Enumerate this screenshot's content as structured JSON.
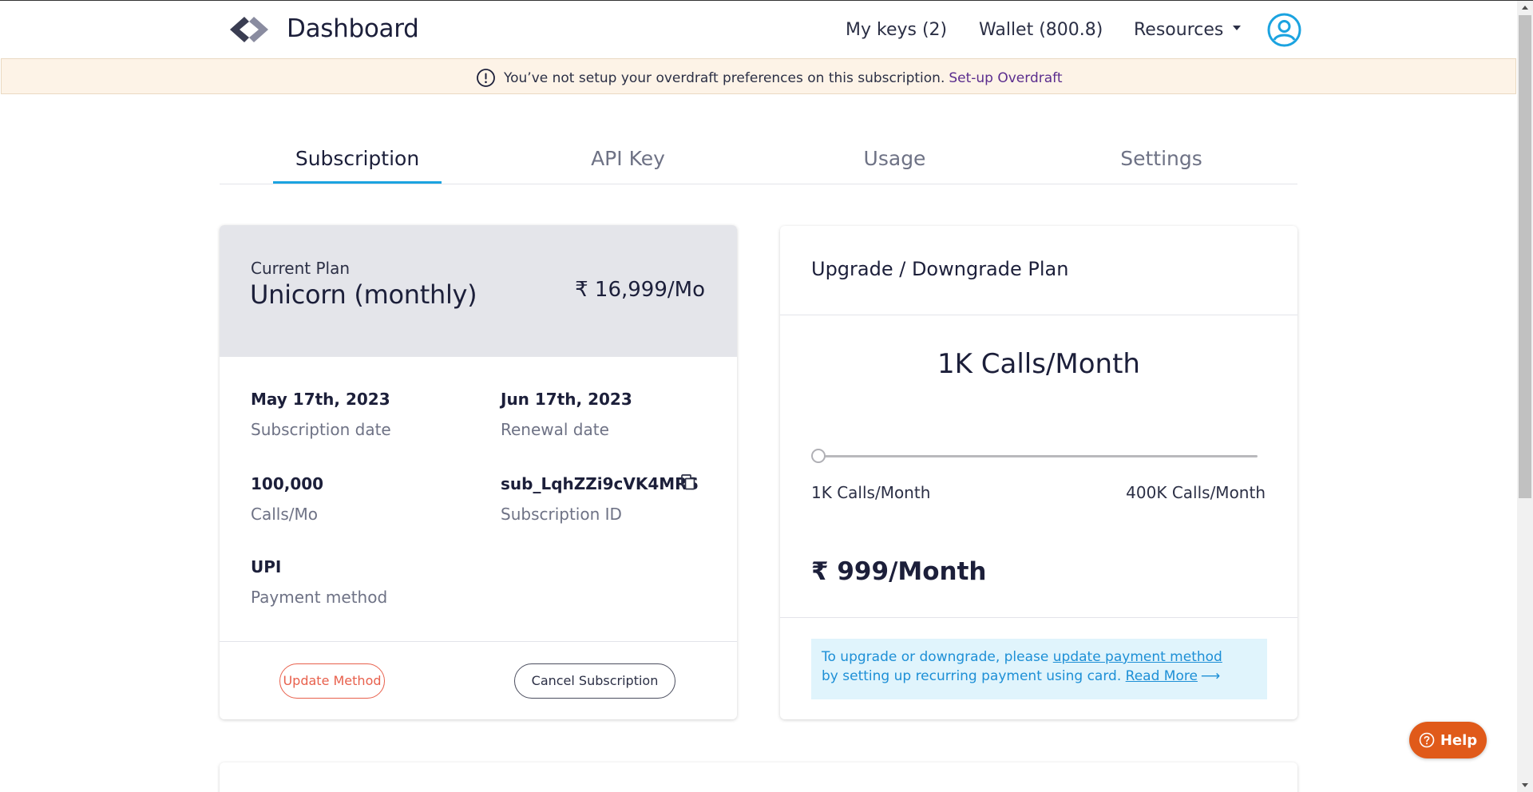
{
  "header": {
    "brand": "Dashboard",
    "nav": {
      "my_keys": "My keys (2)",
      "wallet": "Wallet (800.8)",
      "resources": "Resources"
    }
  },
  "banner": {
    "text": "You’ve not setup your overdraft preferences on this subscription.",
    "link": "Set-up Overdraft"
  },
  "tabs": [
    {
      "label": "Subscription",
      "active": true
    },
    {
      "label": "API Key",
      "active": false
    },
    {
      "label": "Usage",
      "active": false
    },
    {
      "label": "Settings",
      "active": false
    }
  ],
  "current_plan": {
    "label": "Current Plan",
    "name": "Unicorn (monthly)",
    "price": "₹ 16,999/Mo",
    "fields": {
      "subscription_date": {
        "value": "May 17th, 2023",
        "label": "Subscription date"
      },
      "renewal_date": {
        "value": "Jun 17th, 2023",
        "label": "Renewal date"
      },
      "calls": {
        "value": "100,000",
        "label": "Calls/Mo"
      },
      "subscription_id": {
        "value": "sub_LqhZZi9cVK4MRS",
        "label": "Subscription ID"
      },
      "payment_method": {
        "value": "UPI",
        "label": "Payment method"
      }
    },
    "buttons": {
      "update": "Update Method",
      "cancel": "Cancel Subscription"
    }
  },
  "upgrade": {
    "title": "Upgrade / Downgrade Plan",
    "selected_calls": "1K Calls/Month",
    "slider": {
      "min_label": "1K Calls/Month",
      "max_label": "400K Calls/Month",
      "value_fraction": 0
    },
    "price": "₹ 999/Month",
    "info": {
      "text1": "To upgrade or downgrade, please",
      "link1": "update payment method",
      "text2": "by setting up recurring payment using card.",
      "link2": "Read More"
    }
  },
  "help": {
    "label": "Help"
  },
  "colors": {
    "accent": "#1ba3e0",
    "banner_bg": "#fdf3e7",
    "banner_link": "#5b2d8e",
    "danger": "#e8604c",
    "help": "#e05a1a",
    "info_bg": "#e0f4fc",
    "info_text": "#1d8fd6"
  }
}
